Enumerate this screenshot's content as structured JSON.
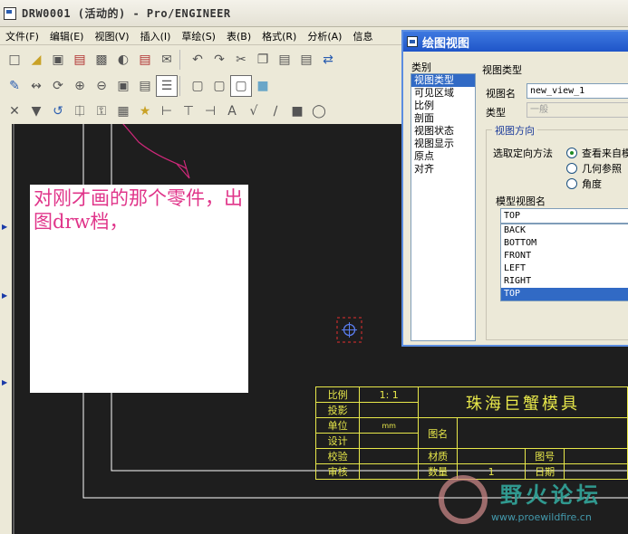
{
  "window": {
    "title": "DRW0001 (活动的) - Pro/ENGINEER"
  },
  "menu": [
    {
      "label": "文件(F)"
    },
    {
      "label": "编辑(E)"
    },
    {
      "label": "视图(V)"
    },
    {
      "label": "插入(I)"
    },
    {
      "label": "草绘(S)"
    },
    {
      "label": "表(B)"
    },
    {
      "label": "格式(R)"
    },
    {
      "label": "分析(A)"
    },
    {
      "label": "信息"
    }
  ],
  "note": {
    "text": "对刚才画的那个零件，出图drw档，"
  },
  "title_block": {
    "scale_label": "比例",
    "scale_value": "1: 1",
    "projection_label": "投影",
    "unit_label": "单位",
    "unit_value": "mm",
    "design_label": "设计",
    "check_label": "校验",
    "review_label": "审核",
    "company": "珠海巨蟹模具",
    "drawing_name_label": "图名",
    "material_label": "材质",
    "drawing_no_label": "图号",
    "quantity_label": "数量",
    "quantity_value": "1",
    "date_label": "日期"
  },
  "watermark": {
    "title": "野火论坛",
    "url": "www.proewildfire.cn"
  },
  "dialog": {
    "title": "绘图视图",
    "category_label": "类别",
    "categories": [
      {
        "label": "视图类型",
        "selected": true
      },
      {
        "label": "可见区域"
      },
      {
        "label": "比例"
      },
      {
        "label": "剖面"
      },
      {
        "label": "视图状态"
      },
      {
        "label": "视图显示"
      },
      {
        "label": "原点"
      },
      {
        "label": "对齐"
      }
    ],
    "view_type_heading": "视图类型",
    "view_name_label": "视图名",
    "view_name_value": "new_view_1",
    "type_label": "类型",
    "type_value": "一般",
    "orientation_group": "视图方向",
    "orientation_method_label": "选取定向方法",
    "radio_options": [
      {
        "label": "查看来自模",
        "checked": true
      },
      {
        "label": "几何参照"
      },
      {
        "label": "角度"
      }
    ],
    "model_view_label": "模型视图名",
    "model_view_value": "TOP",
    "model_views": [
      {
        "label": "BACK"
      },
      {
        "label": "BOTTOM"
      },
      {
        "label": "FRONT"
      },
      {
        "label": "LEFT"
      },
      {
        "label": "RIGHT"
      },
      {
        "label": "TOP",
        "selected": true
      }
    ]
  },
  "colors": {
    "canvas": "#1e1e1e",
    "border_lines": "#ffffff",
    "title_block": "#e8e84a",
    "note_text": "#e0358a",
    "selection": "#316ac5"
  }
}
